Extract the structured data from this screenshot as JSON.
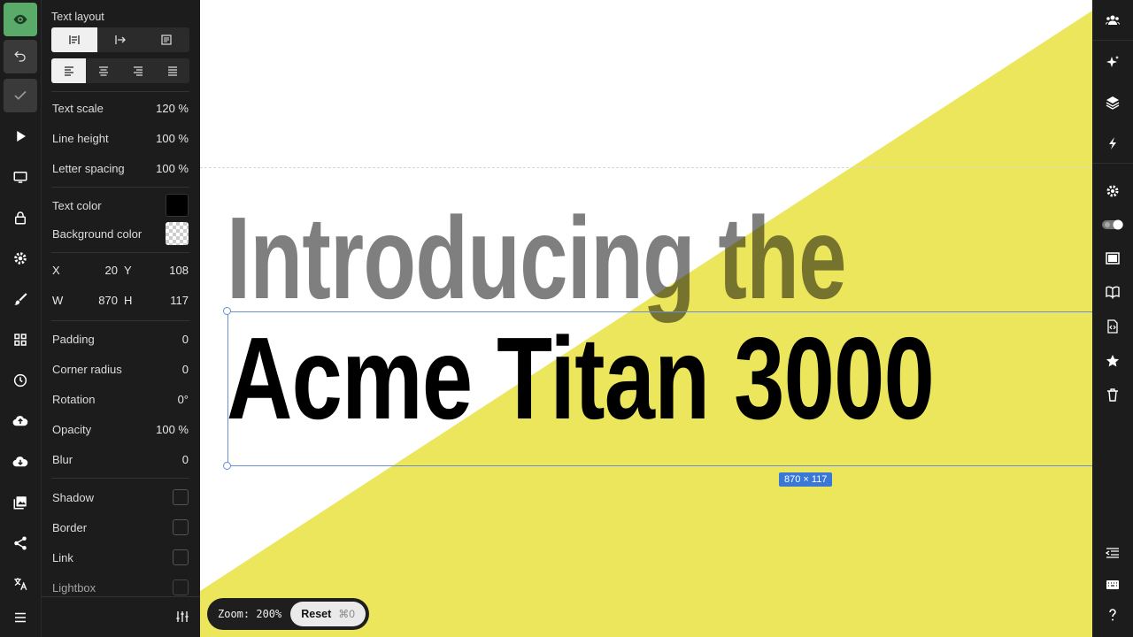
{
  "panel": {
    "text_layout_title": "Text layout",
    "text_scale": {
      "label": "Text scale",
      "value": "120 %"
    },
    "line_height": {
      "label": "Line height",
      "value": "100 %"
    },
    "letter_spacing": {
      "label": "Letter spacing",
      "value": "100 %"
    },
    "text_color": {
      "label": "Text color",
      "value": "#000000"
    },
    "background_color": {
      "label": "Background color",
      "value": "transparent"
    },
    "x": {
      "label": "X",
      "value": "20"
    },
    "y": {
      "label": "Y",
      "value": "108"
    },
    "w": {
      "label": "W",
      "value": "870"
    },
    "h": {
      "label": "H",
      "value": "117"
    },
    "padding": {
      "label": "Padding",
      "value": "0"
    },
    "corner_radius": {
      "label": "Corner radius",
      "value": "0"
    },
    "rotation": {
      "label": "Rotation",
      "value": "0°"
    },
    "opacity": {
      "label": "Opacity",
      "value": "100 %"
    },
    "blur": {
      "label": "Blur",
      "value": "0"
    },
    "shadow": {
      "label": "Shadow",
      "checked": false
    },
    "border": {
      "label": "Border",
      "checked": false
    },
    "link": {
      "label": "Link",
      "checked": false
    },
    "lightbox": {
      "label": "Lightbox",
      "checked": false
    }
  },
  "canvas": {
    "headline_line1": "Introducing the",
    "headline_line2": "Acme Titan 3000",
    "selection_size": "870 × 117",
    "accent_color": "#ebe65b",
    "selection_color": "#3a78d8"
  },
  "zoom": {
    "label": "Zoom: 200%",
    "reset_label": "Reset",
    "reset_shortcut": "⌘0"
  }
}
